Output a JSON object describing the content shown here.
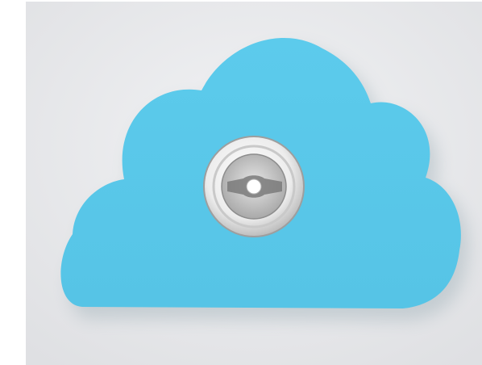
{
  "scene": {
    "subject": "cloud-shaped-plaque-with-lock",
    "colors": {
      "background": "#e9eaec",
      "cloud": "#5bc9eb",
      "cloud_shadow": "#3aa7cc",
      "lock_rim": "#f4f4f4",
      "lock_face": "#cfcfcf",
      "lock_slot": "#7a7a7a"
    }
  }
}
